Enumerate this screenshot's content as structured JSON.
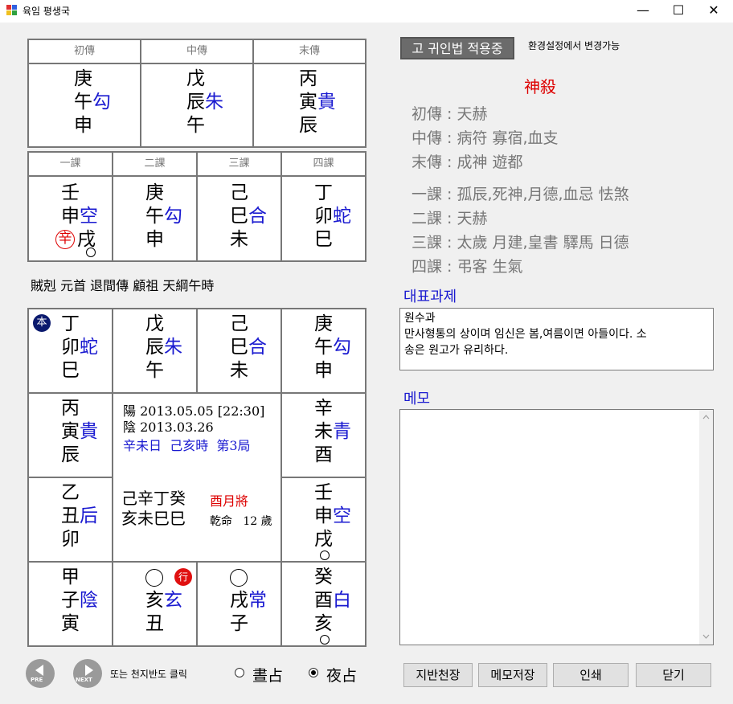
{
  "window": {
    "title": "육임 평생국",
    "minimize": "—",
    "maximize": "☐",
    "close": "✕"
  },
  "top_chuan": {
    "headers": [
      "初傳",
      "中傳",
      "末傳"
    ],
    "cols": [
      {
        "l1": "庚",
        "l2a": "午",
        "l2b": "勾",
        "l3": "申"
      },
      {
        "l1": "戊",
        "l2a": "辰",
        "l2b": "朱",
        "l3": "午"
      },
      {
        "l1": "丙",
        "l2a": "寅",
        "l2b": "貴",
        "l3": "辰"
      }
    ]
  },
  "ke": {
    "headers": [
      "一課",
      "二課",
      "三課",
      "四課"
    ],
    "cols": [
      {
        "l1": "壬",
        "l2a": "申",
        "l2b": "空",
        "l3a": "辛",
        "l3b": "戌"
      },
      {
        "l1": "庚",
        "l2a": "午",
        "l2b": "勾",
        "l3a": "",
        "l3b": "申"
      },
      {
        "l1": "己",
        "l2a": "巳",
        "l2b": "合",
        "l3a": "",
        "l3b": "未"
      },
      {
        "l1": "丁",
        "l2a": "卯",
        "l2b": "蛇",
        "l3a": "",
        "l3b": "巳"
      }
    ]
  },
  "ke_summary": "賊剋 元首 退間傳 顧祖 天綱午時",
  "board": {
    "badge": "本",
    "row1": [
      {
        "l1": "丁",
        "l2a": "卯",
        "l2b": "蛇",
        "l3": "巳"
      },
      {
        "l1": "戊",
        "l2a": "辰",
        "l2b": "朱",
        "l3": "午"
      },
      {
        "l1": "己",
        "l2a": "巳",
        "l2b": "合",
        "l3": "未"
      },
      {
        "l1": "庚",
        "l2a": "午",
        "l2b": "勾",
        "l3": "申"
      }
    ],
    "left2": {
      "l1": "丙",
      "l2a": "寅",
      "l2b": "貴",
      "l3": "辰"
    },
    "right2": {
      "l1": "辛",
      "l2a": "未",
      "l2b": "青",
      "l3": "酉"
    },
    "left3": {
      "l1": "乙",
      "l2a": "丑",
      "l2b": "后",
      "l3": "卯"
    },
    "right3": {
      "l1": "壬",
      "l2a": "申",
      "l2b": "空",
      "l3": "戌"
    },
    "row4": [
      {
        "l1": "甲",
        "l2a": "子",
        "l2b": "陰",
        "l3": "寅"
      },
      {
        "l1": "",
        "l2a": "亥",
        "l2b": "玄",
        "l3": "丑"
      },
      {
        "l1": "",
        "l2a": "戌",
        "l2b": "常",
        "l3": "子"
      },
      {
        "l1": "癸",
        "l2a": "酉",
        "l2b": "白",
        "l3": "亥"
      }
    ],
    "xing_badge": "行",
    "center": {
      "yang": "陽 2013.05.05 [22:30]",
      "yin": "陰 2013.03.26",
      "day": "辛未日",
      "hour": "己亥時",
      "ju": "第3局",
      "pillars_top": "己辛丁癸",
      "pillars_bottom": "亥未巳巳",
      "yuejiang": "酉月將",
      "ming": "乾命",
      "age": "12 歲"
    }
  },
  "bottom_nav": {
    "prev": "PRE",
    "next": "NEXT",
    "hint": "또는 천지반도 클릭"
  },
  "radio": {
    "day": "晝占",
    "night": "夜占",
    "selected": "night"
  },
  "right": {
    "guiin_button": "고 귀인법 적용중",
    "guiin_note": "환경설정에서 변경가능",
    "shensha_title": "神殺",
    "shensha": [
      "初傳 :  天赫",
      "中傳 : 病符 寡宿,血支",
      "末傳 :  成神   遊都",
      "一課 :  孤辰,死神,月德,血忌 怯煞",
      "二課 :  天赫",
      "三課 : 太歲 月建,皇書 驛馬 日德",
      "四課 : 弔客 生氣"
    ],
    "rep_title": "대표과제",
    "rep_text_line1": "원수과",
    "rep_text_line2": "만사형통의 상이며 임신은 봄,여름이면 아들이다. 소",
    "rep_text_line3": "송은 원고가 유리하다.",
    "memo_title": "메모",
    "buttons": [
      "지반천장",
      "메모저장",
      "인쇄",
      "닫기"
    ]
  },
  "colors": {
    "blue": "#1a1ad0",
    "red": "#dd0000",
    "title_blue": "#1a1ad0"
  }
}
